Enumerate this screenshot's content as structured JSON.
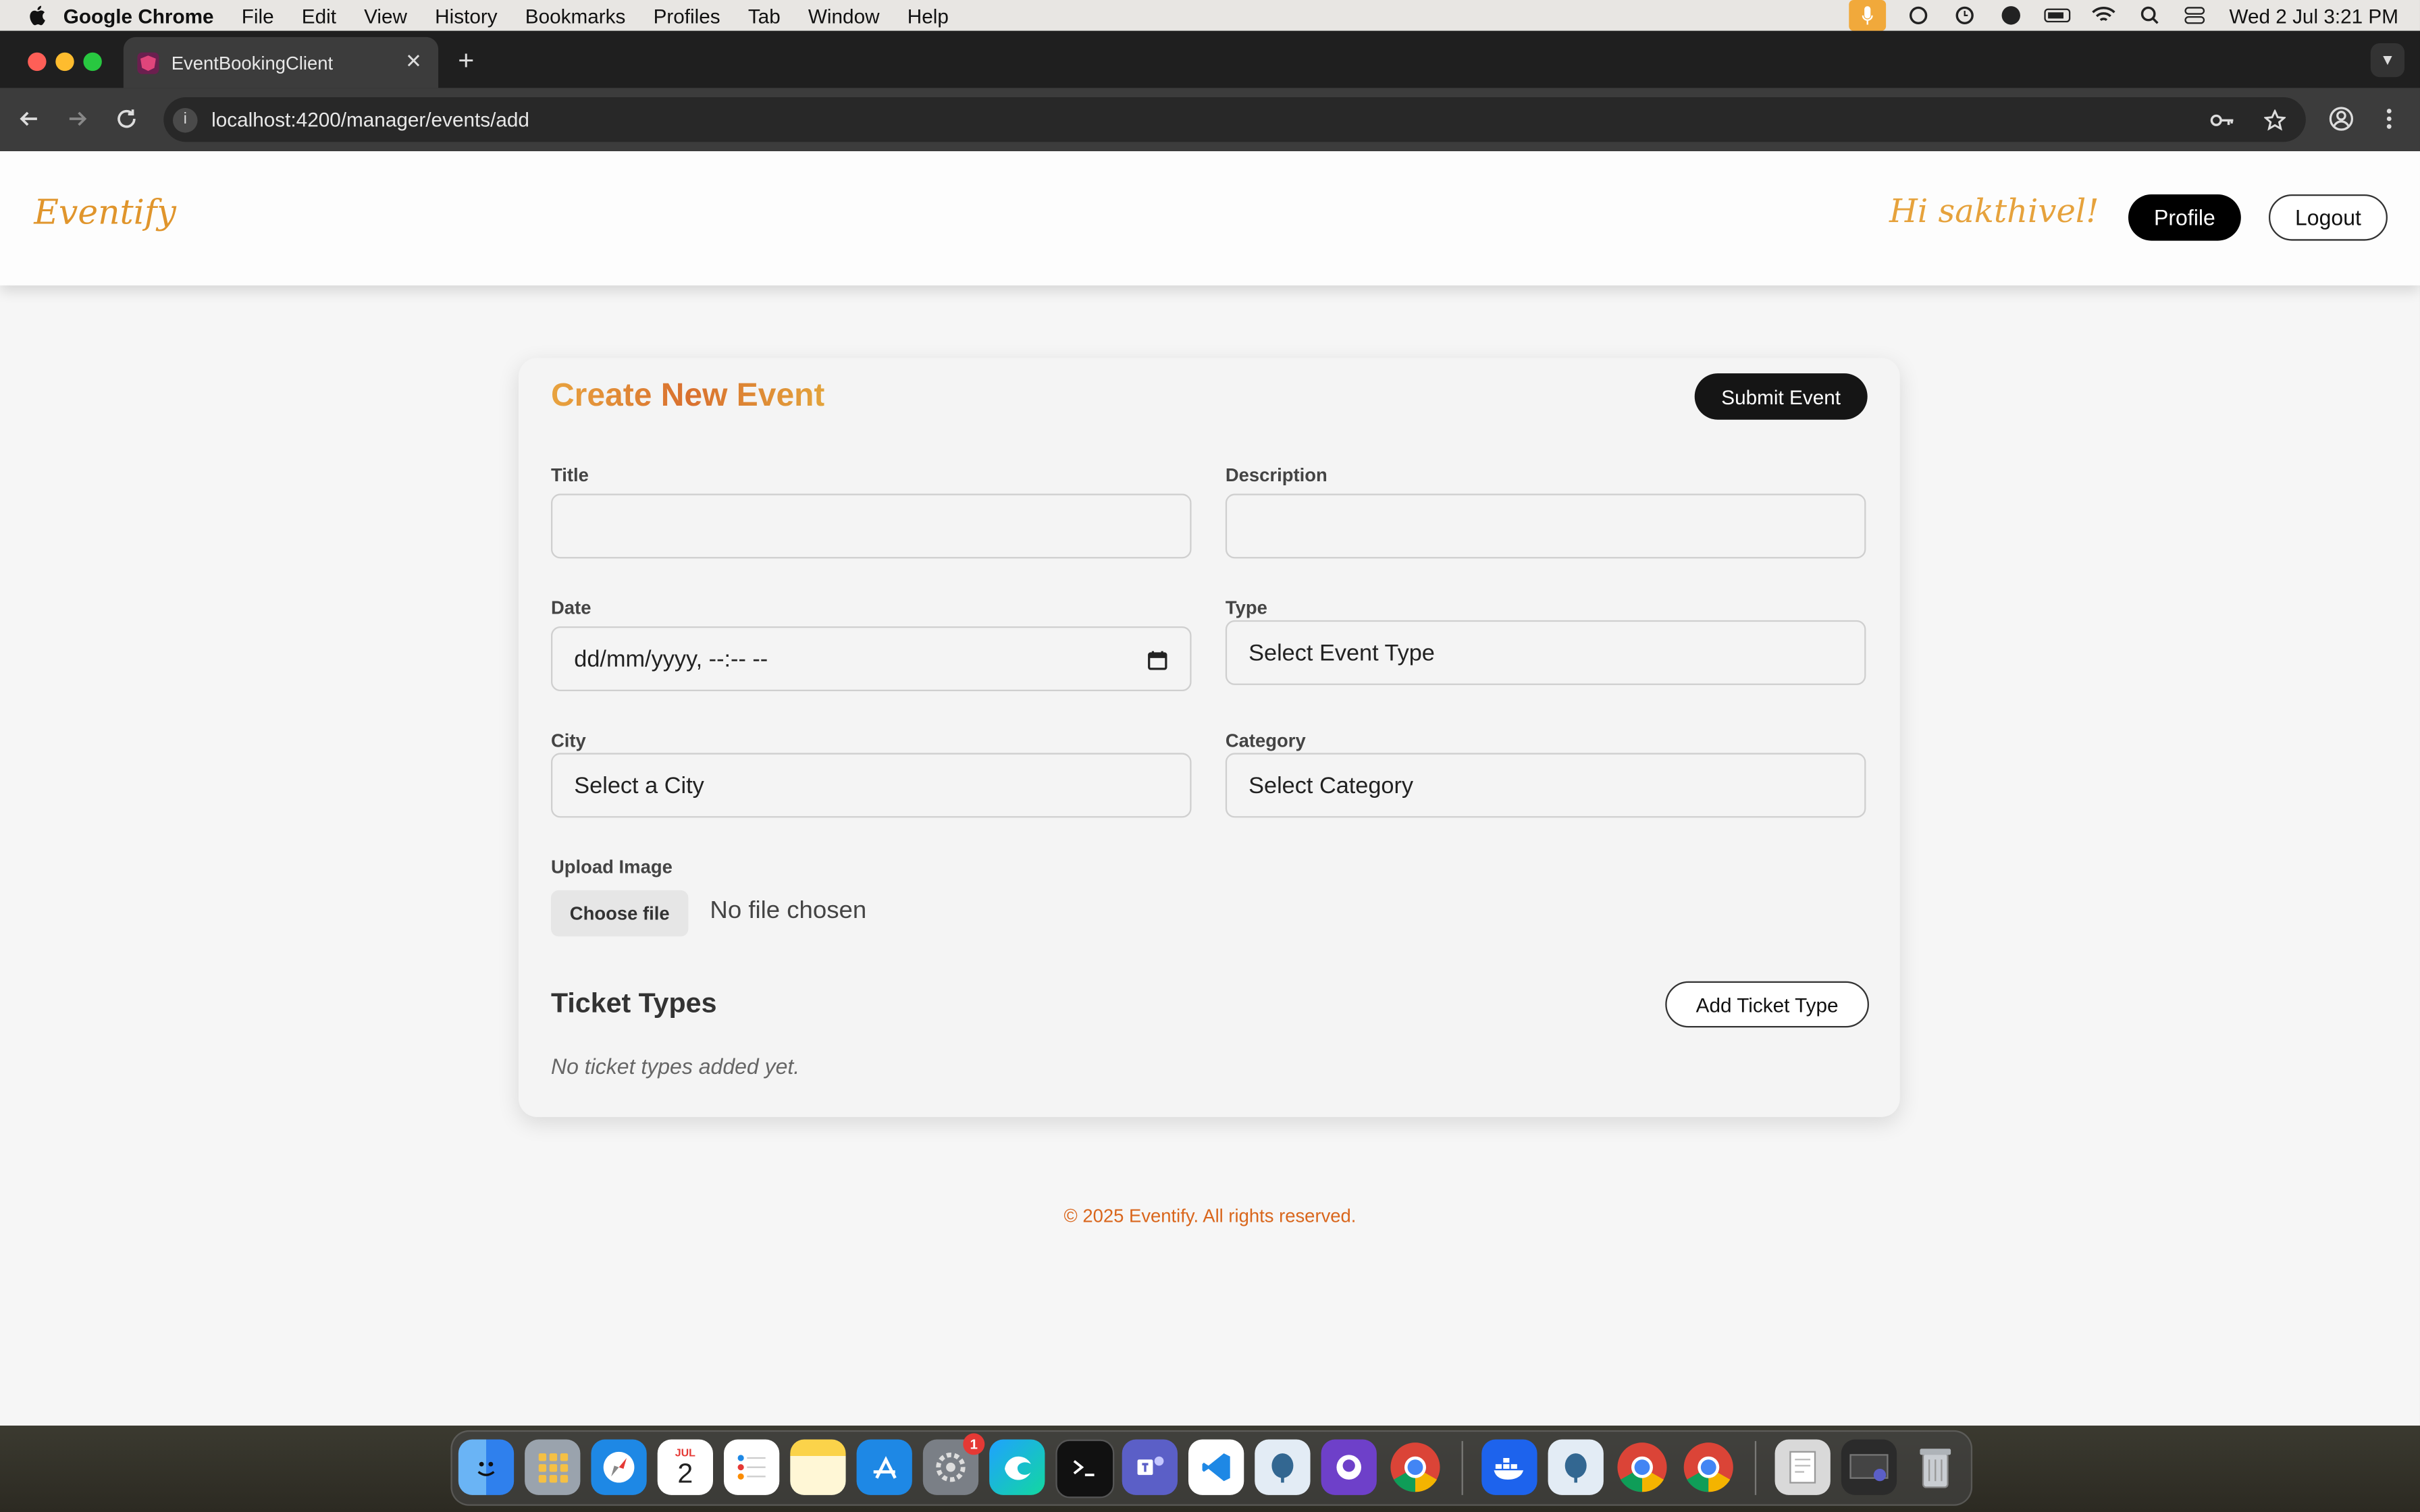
{
  "menubar": {
    "app": "Google Chrome",
    "items": [
      "File",
      "Edit",
      "View",
      "History",
      "Bookmarks",
      "Profiles",
      "Tab",
      "Window",
      "Help"
    ],
    "datetime": "Wed 2 Jul  3:21 PM"
  },
  "browser": {
    "tab_title": "EventBookingClient",
    "url": "localhost:4200/manager/events/add"
  },
  "navbar": {
    "brand": "Eventify",
    "greeting": "Hi sakthivel!",
    "profile_label": "Profile",
    "logout_label": "Logout"
  },
  "form": {
    "heading": "Create New Event",
    "submit_label": "Submit Event",
    "title_label": "Title",
    "description_label": "Description",
    "date_label": "Date",
    "date_placeholder": "dd/mm/yyyy, --:-- --",
    "type_label": "Type",
    "type_value": "Select Event Type",
    "city_label": "City",
    "city_value": "Select a City",
    "category_label": "Category",
    "category_value": "Select Category",
    "upload_label": "Upload Image",
    "choose_file_label": "Choose file",
    "file_status": "No file chosen",
    "ticket_types_heading": "Ticket Types",
    "add_ticket_label": "Add Ticket Type",
    "ticket_empty": "No ticket types added yet."
  },
  "footer": {
    "text": "© 2025 Eventify. All rights reserved."
  },
  "dock": {
    "calendar_month": "JUL",
    "calendar_day": "2",
    "settings_badge": "1"
  },
  "colors": {
    "brand": "#e0952c",
    "footer": "#d9661c",
    "dark_button": "#151515"
  }
}
